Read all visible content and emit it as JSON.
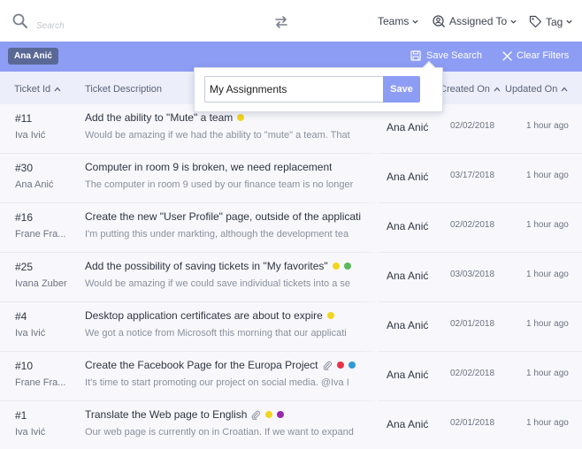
{
  "search": {
    "placeholder": "Search",
    "value": ""
  },
  "filters": {
    "teams": "Teams",
    "assigned_to": "Assigned To",
    "tag": "Tag"
  },
  "filterbar": {
    "chip": "Ana Anić",
    "save_search": "Save Search",
    "clear_filters": "Clear Filters"
  },
  "popup": {
    "input_value": "My Assignments",
    "save": "Save"
  },
  "columns": {
    "id": "Ticket Id",
    "description": "Ticket Description",
    "created": "Created On",
    "updated": "Updated On"
  },
  "rows": [
    {
      "id": "#11",
      "requester": "Iva Ivić",
      "title": "Add the ability to \"Mute\" a team",
      "desc": "Would be amazing if we had the ability to \"mute\" a team. That",
      "assignee": "Ana Anić",
      "created": "02/02/2018",
      "updated": "1 hour ago",
      "attachment": false,
      "tags": [
        "#f2d51f"
      ]
    },
    {
      "id": "#30",
      "requester": "Ana Anić",
      "title": "Computer in room 9 is broken, we need replacement",
      "desc": "The computer in room 9 used by our finance team is no longer",
      "assignee": "Ana Anić",
      "created": "03/17/2018",
      "updated": "1 hour ago",
      "attachment": false,
      "tags": []
    },
    {
      "id": "#16",
      "requester": "Frane Fra...",
      "title": "Create the new \"User Profile\" page, outside of the applicati",
      "desc": "I'm putting this under markting, although the development tea",
      "assignee": "Ana Anić",
      "created": "02/02/2018",
      "updated": "1 hour ago",
      "attachment": false,
      "tags": []
    },
    {
      "id": "#25",
      "requester": "Ivana Zuber",
      "title": "Add the possibility of saving tickets in \"My favorites\"",
      "desc": "Would be amazing if we could save individual tickets into a se",
      "assignee": "Ana Anić",
      "created": "03/03/2018",
      "updated": "1 hour ago",
      "attachment": false,
      "tags": [
        "#f2d51f",
        "#5cb85c"
      ]
    },
    {
      "id": "#4",
      "requester": "Iva Ivić",
      "title": "Desktop application certificates are about to expire",
      "desc": "We got a notice from Microsoft this morning that our applicati",
      "assignee": "Ana Anić",
      "created": "02/01/2018",
      "updated": "1 hour ago",
      "attachment": false,
      "tags": [
        "#f2d51f"
      ]
    },
    {
      "id": "#10",
      "requester": "Frane Fra...",
      "title": "Create the Facebook Page for the Europa Project",
      "desc": "It's time to start promoting our project on social media. @Iva I",
      "assignee": "Ana Anić",
      "created": "02/02/2018",
      "updated": "1 hour ago",
      "attachment": true,
      "tags": [
        "#e8334a",
        "#2e9bd8"
      ]
    },
    {
      "id": "#1",
      "requester": "Iva Ivić",
      "title": "Translate the Web page to English",
      "desc": "Our web page is currently on in Croatian. If we want to expand",
      "assignee": "Ana Anić",
      "created": "02/01/2018",
      "updated": "1 hour ago",
      "attachment": true,
      "tags": [
        "#f2d51f",
        "#9b27af"
      ]
    }
  ]
}
